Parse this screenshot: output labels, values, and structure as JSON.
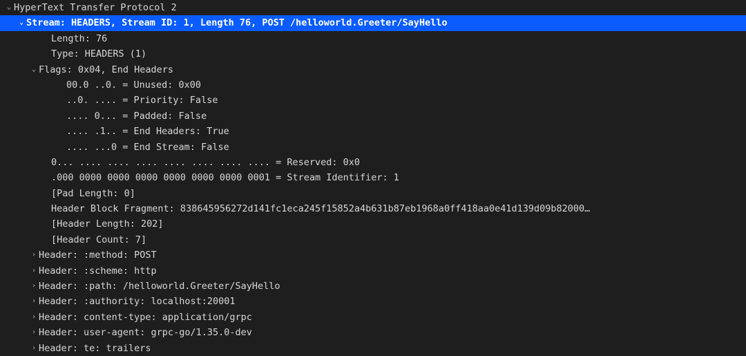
{
  "root": {
    "text": "HyperText Transfer Protocol 2",
    "arrow": "v",
    "expanded": true
  },
  "stream": {
    "text": "Stream: HEADERS, Stream ID: 1, Length 76, POST /helloworld.Greeter/SayHello",
    "arrow": "v",
    "expanded": true,
    "selected": true
  },
  "length": {
    "text": "Length: 76"
  },
  "type": {
    "text": "Type: HEADERS (1)"
  },
  "flags": {
    "text": "Flags: 0x04, End Headers",
    "arrow": "v",
    "expanded": true,
    "bits": [
      "00.0 ..0. = Unused: 0x00",
      "..0. .... = Priority: False",
      ".... 0... = Padded: False",
      ".... .1.. = End Headers: True",
      ".... ...0 = End Stream: False"
    ]
  },
  "reserved": {
    "text": "0... .... .... .... .... .... .... .... = Reserved: 0x0"
  },
  "stream_id": {
    "text": ".000 0000 0000 0000 0000 0000 0000 0001 = Stream Identifier: 1"
  },
  "pad_len": {
    "text": "[Pad Length: 0]"
  },
  "hbf": {
    "text": "Header Block Fragment: 838645956272d141fc1eca245f15852a4b631b87eb1968a0ff418aa0e41d139d09b82000…"
  },
  "hdr_len": {
    "text": "[Header Length: 202]"
  },
  "hdr_count": {
    "text": "[Header Count: 7]"
  },
  "headers": [
    "Header: :method: POST",
    "Header: :scheme: http",
    "Header: :path: /helloworld.Greeter/SayHello",
    "Header: :authority: localhost:20001",
    "Header: content-type: application/grpc",
    "Header: user-agent: grpc-go/1.35.0-dev",
    "Header: te: trailers"
  ],
  "glyphs": {
    "expanded": "⌄",
    "collapsed": "›"
  }
}
